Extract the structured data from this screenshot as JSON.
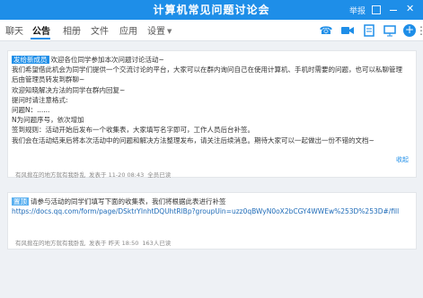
{
  "window": {
    "title": "计算机常见问题讨论会",
    "report_label": "举报",
    "close_glyph": "✕"
  },
  "tabs": [
    {
      "label": "聊天"
    },
    {
      "label": "公告"
    },
    {
      "label": "相册"
    },
    {
      "label": "文件"
    },
    {
      "label": "应用"
    },
    {
      "label": "设置"
    }
  ],
  "toolbar_icons": [
    "phone-icon",
    "video-icon",
    "document-icon",
    "screen-share-icon",
    "add-icon",
    "more-icon"
  ],
  "announcements": [
    {
      "tag": "发给新成员",
      "first_line": "欢迎各位同学参加本次问题讨论活动~",
      "lines": [
        "我们希望借此机会为同学们提供一个交流讨论的平台，大家可以在群内询问自己在使用计算机、手机时需要的问题，也可以私聊管理",
        "后由管理员转发到群聊~",
        "欢迎知晓解决方法的同学在群内回复~",
        "提问时请注意格式:",
        "问题N：......",
        "N为问题序号，依次增加",
        "签到规则：活动开始后发布一个收集表，大家填写名字即可，工作人员后台补签。",
        "我们会在活动结束后将本次活动中的问题和解决方法整理发布，请关注后续消息。期待大家可以一起做出一份不错的文档~"
      ],
      "collapse_label": "收起",
      "author": "有风掀在的地方就有我卧乱",
      "posted": "发表于 11-20 08:43",
      "views": "全员已读"
    },
    {
      "tag": "置顶",
      "first_line": "请参与活动的同学们填写下面的收集表，我们将根据此表进行补签",
      "lines": [
        "https://docs.qq.com/form/page/DSktrYInhtDQUhtRlBp?groupUin=uzz0qBWyN0oX2bCGY4WWEw%253D%253D#/fill"
      ],
      "author": "有风掀在的地方就有我卧乱",
      "posted": "发表于 昨天 18:50",
      "views": "163人已读"
    }
  ]
}
